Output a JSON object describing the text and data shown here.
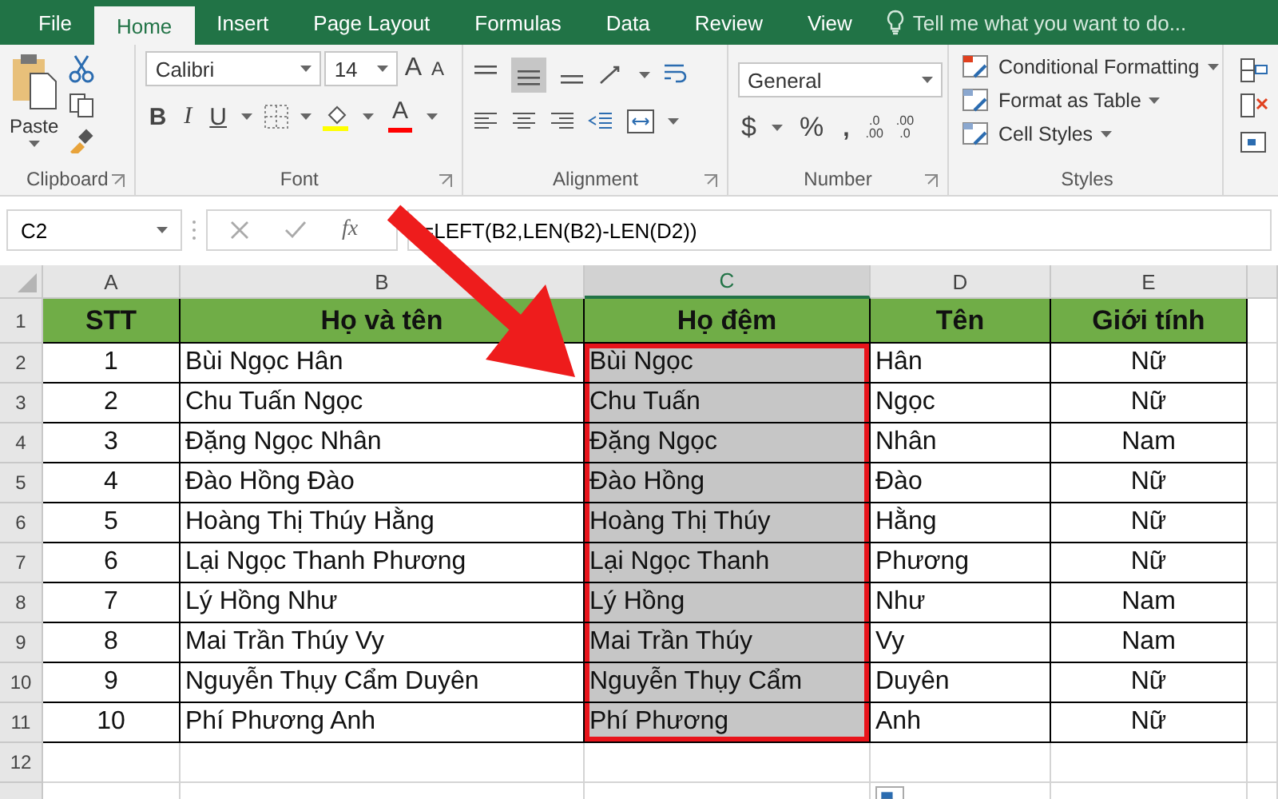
{
  "tabs": [
    {
      "label": "File",
      "selected": false
    },
    {
      "label": "Home",
      "selected": true
    },
    {
      "label": "Insert",
      "selected": false
    },
    {
      "label": "Page Layout",
      "selected": false
    },
    {
      "label": "Formulas",
      "selected": false
    },
    {
      "label": "Data",
      "selected": false
    },
    {
      "label": "Review",
      "selected": false
    },
    {
      "label": "View",
      "selected": false
    }
  ],
  "tell_me": {
    "placeholder": "Tell me what you want to do..."
  },
  "ribbon": {
    "clipboard": {
      "paste": "Paste",
      "label": "Clipboard"
    },
    "font": {
      "name": "Calibri",
      "size": "14",
      "bold": "B",
      "italic": "I",
      "underline": "U",
      "grow": "A",
      "shrink": "A",
      "font_color_label": "A",
      "label": "Font"
    },
    "alignment": {
      "label": "Alignment"
    },
    "number": {
      "format": "General",
      "currency": "$",
      "percent": "%",
      "comma": ",",
      "increase_decimal": [
        ".0",
        ".00"
      ],
      "decrease_decimal": [
        ".00",
        ".0"
      ],
      "label": "Number"
    },
    "styles": {
      "items": [
        "Conditional Formatting",
        "Format as Table",
        "Cell Styles"
      ],
      "label": "Styles"
    }
  },
  "formula_bar": {
    "name_box": "C2",
    "fx": "fx",
    "formula": "=LEFT(B2,LEN(B2)-LEN(D2))"
  },
  "sheet": {
    "columns": [
      {
        "letter": "A",
        "selected": false
      },
      {
        "letter": "B",
        "selected": false
      },
      {
        "letter": "C",
        "selected": true
      },
      {
        "letter": "D",
        "selected": false
      },
      {
        "letter": "E",
        "selected": false
      }
    ],
    "rows": [
      {
        "number": "1",
        "cells": [
          "STT",
          "Họ và tên",
          "Họ đệm",
          "Tên",
          "Giới tính"
        ]
      },
      {
        "number": "2",
        "cells": [
          "1",
          "Bùi Ngọc Hân",
          "Bùi Ngọc",
          "Hân",
          "Nữ"
        ]
      },
      {
        "number": "3",
        "cells": [
          "2",
          "Chu Tuấn Ngọc",
          "Chu Tuấn",
          "Ngọc",
          "Nữ"
        ]
      },
      {
        "number": "4",
        "cells": [
          "3",
          "Đặng Ngọc Nhân",
          "Đặng Ngọc",
          "Nhân",
          "Nam"
        ]
      },
      {
        "number": "5",
        "cells": [
          "4",
          "Đào Hồng Đào",
          "Đào Hồng",
          "Đào",
          "Nữ"
        ]
      },
      {
        "number": "6",
        "cells": [
          "5",
          "Hoàng Thị Thúy Hằng",
          "Hoàng Thị Thúy",
          "Hằng",
          "Nữ"
        ]
      },
      {
        "number": "7",
        "cells": [
          "6",
          "Lại Ngọc Thanh Phương",
          "Lại Ngọc Thanh",
          "Phương",
          "Nữ"
        ]
      },
      {
        "number": "8",
        "cells": [
          "7",
          "Lý Hồng Như",
          "Lý Hồng",
          "Như",
          "Nam"
        ]
      },
      {
        "number": "9",
        "cells": [
          "8",
          "Mai Trần Thúy Vy",
          "Mai Trần Thúy",
          "Vy",
          "Nam"
        ]
      },
      {
        "number": "10",
        "cells": [
          "9",
          "Nguyễn Thụy Cẩm Duyên",
          "Nguyễn Thụy Cẩm",
          "Duyên",
          "Nữ"
        ]
      },
      {
        "number": "11",
        "cells": [
          "10",
          "Phí Phương Anh",
          "Phí Phương",
          "Anh",
          "Nữ"
        ]
      },
      {
        "number": "12",
        "cells": []
      }
    ]
  }
}
